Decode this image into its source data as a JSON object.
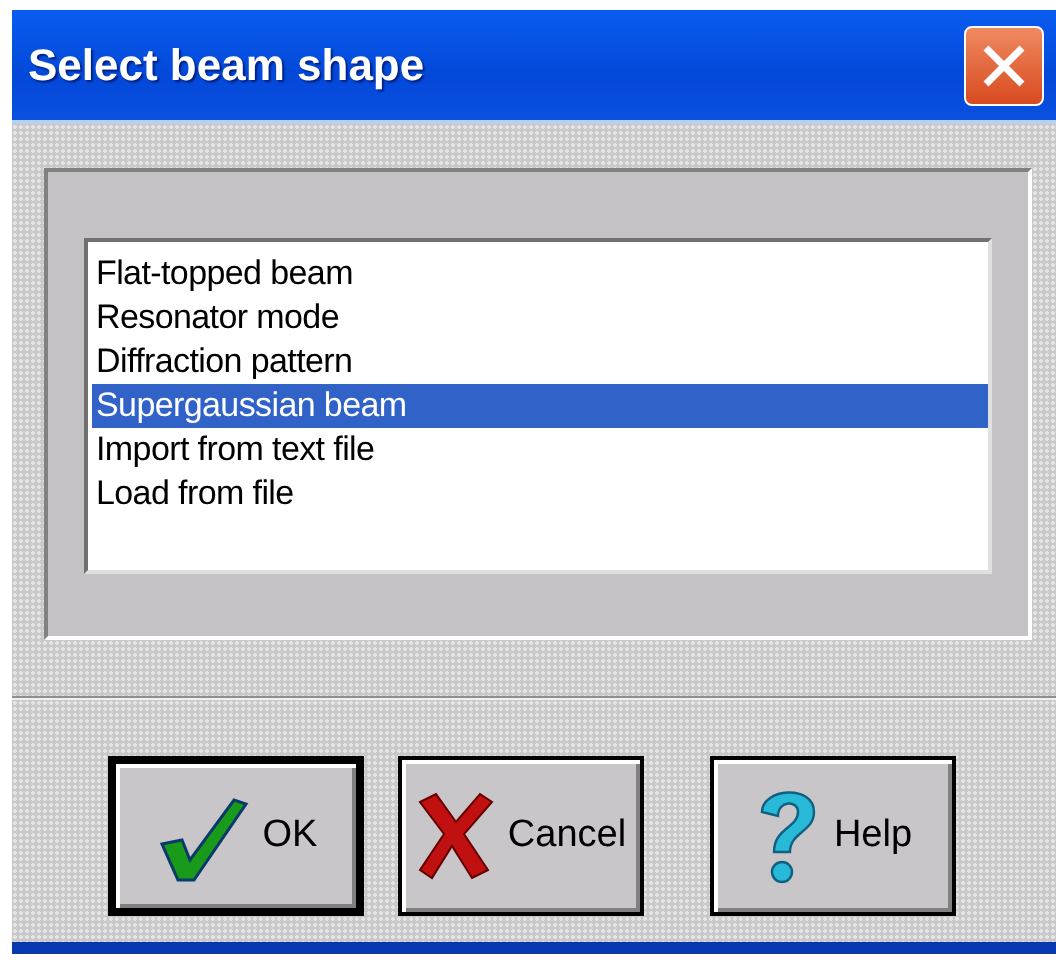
{
  "window": {
    "title": "Select beam shape"
  },
  "list": {
    "items": [
      {
        "label": "Flat-topped beam",
        "selected": false
      },
      {
        "label": "Resonator mode",
        "selected": false
      },
      {
        "label": "Diffraction pattern",
        "selected": false
      },
      {
        "label": "Supergaussian beam",
        "selected": true
      },
      {
        "label": "Import from text file",
        "selected": false
      },
      {
        "label": "Load from file",
        "selected": false
      }
    ]
  },
  "buttons": [
    {
      "kind": "ok",
      "label": "OK",
      "default": true
    },
    {
      "kind": "cancel",
      "label": "Cancel",
      "default": false
    },
    {
      "kind": "help",
      "label": "Help",
      "default": false
    }
  ]
}
